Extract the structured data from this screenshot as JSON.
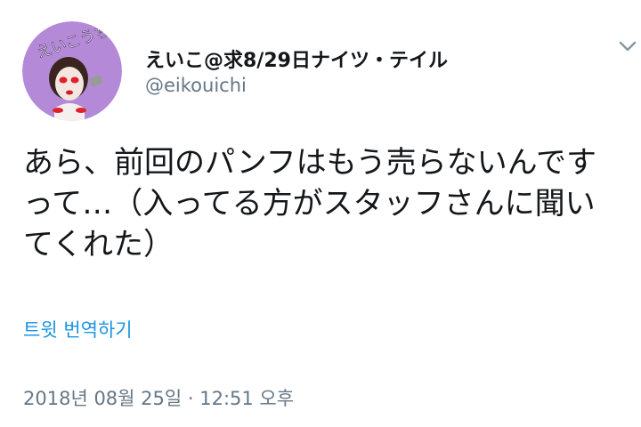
{
  "tweet": {
    "author": {
      "display_name": "えいこ@求8/29日ナイツ・テイル",
      "handle": "@eikouichi",
      "avatar_text": "えいこうちょ"
    },
    "text": "あら、前回のパンフはもう売らないんですって…（入ってる方がスタッフさんに聞いてくれた）",
    "translate_label": "트윗 번역하기",
    "timestamp": "2018년 08월 25일 · 12:51 오후",
    "menu_icon": "chevron-down-icon"
  },
  "colors": {
    "link": "#1b95e0",
    "secondary_text": "#657786",
    "primary_text": "#14171a",
    "avatar_bg": "#b48ad8"
  }
}
